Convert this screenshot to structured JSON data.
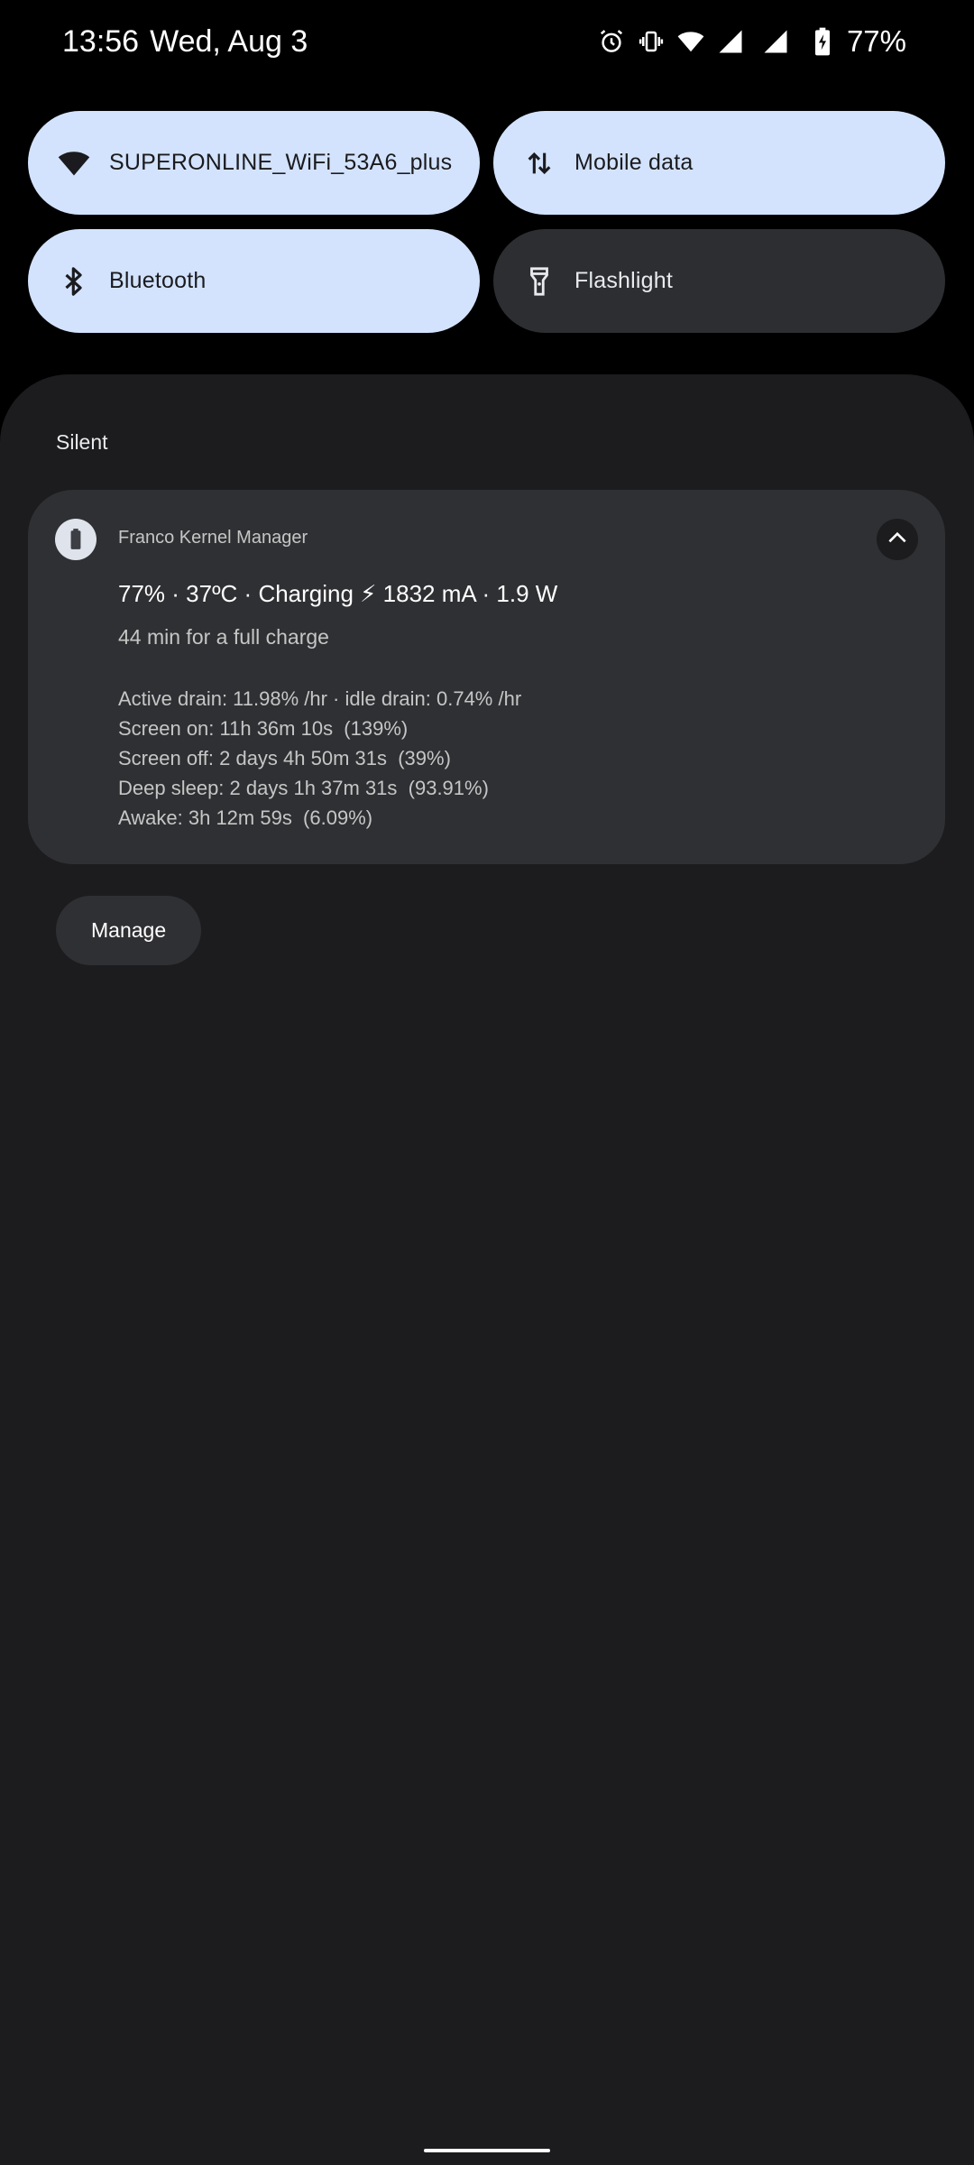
{
  "status_bar": {
    "time": "13:56",
    "date": "Wed, Aug 3",
    "battery_percent": "77%",
    "icons": [
      "alarm-icon",
      "vibrate-icon",
      "wifi-icon",
      "signal-icon",
      "signal-icon",
      "battery-charging-icon"
    ]
  },
  "quick_tiles": [
    {
      "label": "SUPERONLINE_WiFi_53A6_plus",
      "icon": "wifi-icon",
      "state": "on"
    },
    {
      "label": "Mobile data",
      "icon": "mobile-data-icon",
      "state": "on"
    },
    {
      "label": "Bluetooth",
      "icon": "bluetooth-icon",
      "state": "on"
    },
    {
      "label": "Flashlight",
      "icon": "flashlight-icon",
      "state": "off"
    }
  ],
  "shade": {
    "section_header": "Silent",
    "notification": {
      "app_name": "Franco Kernel Manager",
      "app_icon": "battery-icon",
      "title": "77% · 37ºC · Charging ⚡ 1832 mA · 1.9 W",
      "subtitle": "44 min for a full charge",
      "lines": [
        "Active drain: 11.98% /hr · idle drain: 0.74% /hr",
        "Screen on: 11h 36m 10s  (139%)",
        "Screen off: 2 days 4h 50m 31s  (39%)",
        "Deep sleep: 2 days 1h 37m 31s  (93.91%)",
        "Awake: 3h 12m 59s  (6.09%)"
      ],
      "expanded": true
    },
    "manage_label": "Manage"
  },
  "colors": {
    "tile_on": "#d3e3fd",
    "tile_off": "#2d2e31",
    "shade_bg": "#1c1c1e",
    "card_bg": "#2f3033"
  }
}
